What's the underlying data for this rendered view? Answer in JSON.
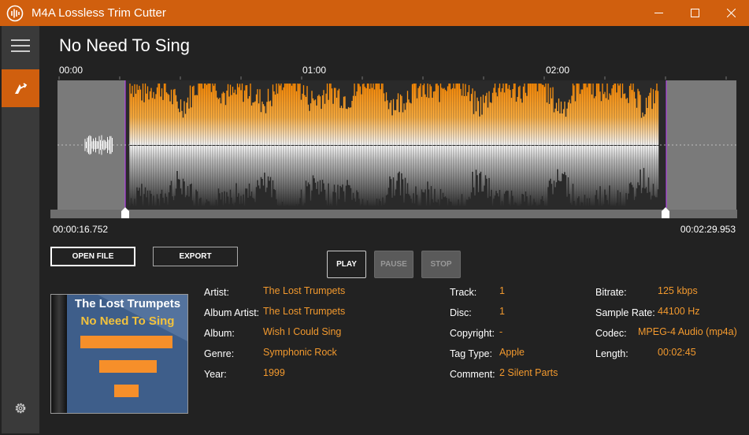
{
  "window": {
    "title": "M4A Lossless Trim Cutter",
    "controls": [
      "minimize",
      "maximize",
      "close"
    ]
  },
  "sidebar": {
    "items": [
      {
        "icon": "hamburger-menu-icon"
      },
      {
        "icon": "trim-arrow-icon",
        "active": true
      },
      {
        "icon": "gear-icon"
      }
    ]
  },
  "song_title": "No Need To Sing",
  "timeline": {
    "ticks": [
      "00:00",
      "01:00",
      "02:00"
    ],
    "trim_start": "00:00:16.752",
    "trim_end": "00:02:29.953"
  },
  "buttons": {
    "open_file": "OPEN FILE",
    "export": "EXPORT",
    "play": "PLAY",
    "pause": "PAUSE",
    "stop": "STOP"
  },
  "cover": {
    "artist": "The Lost Trumpets",
    "title": "No Need To Sing"
  },
  "metadata": {
    "col1": [
      {
        "label": "Artist:",
        "value": "The Lost Trumpets"
      },
      {
        "label": "Album Artist:",
        "value": "The Lost Trumpets"
      },
      {
        "label": "Album:",
        "value": "Wish I Could Sing"
      },
      {
        "label": "Genre:",
        "value": "Symphonic Rock"
      },
      {
        "label": "Year:",
        "value": "1999"
      }
    ],
    "col2": [
      {
        "label": "Track:",
        "value": "1"
      },
      {
        "label": "Disc:",
        "value": "1"
      },
      {
        "label": "Copyright:",
        "value": "-"
      },
      {
        "label": "Tag Type:",
        "value": "Apple"
      },
      {
        "label": "Comment:",
        "value": "2 Silent Parts"
      }
    ],
    "col3": [
      {
        "label": "Bitrate:",
        "value": "125 kbps"
      },
      {
        "label": "Sample Rate:",
        "value": "44100 Hz"
      },
      {
        "label": "Codec:",
        "value": "MPEG-4 Audio (mp4a)"
      },
      {
        "label": "Length:",
        "value": "00:02:45"
      }
    ]
  },
  "colors": {
    "accent": "#d05f0e",
    "value_text": "#f2992e",
    "background": "#222222",
    "sidebar": "#3a3a3a"
  }
}
